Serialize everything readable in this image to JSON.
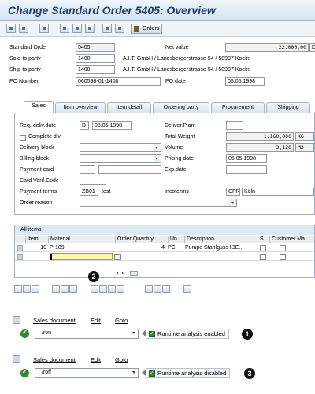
{
  "window": {
    "title": "Change Standard Order 5405: Overview"
  },
  "toolbar": {
    "orders_label": "Orders"
  },
  "header": {
    "standard_order_label": "Standard Order",
    "standard_order_value": "5405",
    "net_value_label": "Net value",
    "net_value_value": "22.000,00",
    "currency_value": "D",
    "sold_to_label": "Sold-to party",
    "sold_to_value": "1400",
    "sold_to_desc": "A.I.T. GmbH / Landsbergerstrasse 54 / 50997 Koeln",
    "ship_to_label": "Ship-to party",
    "ship_to_value": "1400",
    "ship_to_desc": "A.I.T. GmbH / Landsbergerstrasse 54 / 50997 Koeln",
    "po_number_label": "PO Number",
    "po_number_value": "060598-01-1400",
    "po_date_label": "PO date",
    "po_date_value": "05.05.1998"
  },
  "tabs": [
    {
      "label": "Sales"
    },
    {
      "label": "Item overview"
    },
    {
      "label": "Item detail"
    },
    {
      "label": "Ordering party"
    },
    {
      "label": "Procurement"
    },
    {
      "label": "Shipping"
    }
  ],
  "sales": {
    "req_deliv_date_label": "Req. deliv.date",
    "req_deliv_date_unit": "D",
    "req_deliv_date_value": "08.05.1998",
    "deliver_plant_label": "Deliver.Plant",
    "complete_dlv_label": "Complete dlv.",
    "total_weight_label": "Total Weight",
    "total_weight_value": "1.160,000",
    "total_weight_unit": "KG",
    "delivery_block_label": "Delivery block",
    "volume_label": "Volume",
    "volume_value": "3,120",
    "volume_unit": "M3",
    "billing_block_label": "Billing block",
    "pricing_date_label": "Pricing date",
    "pricing_date_value": "06.05.1998",
    "payment_card_label": "Payment card",
    "exp_date_label": "Exp.date",
    "card_verif_label": "Card Verif.Code",
    "payment_terms_label": "Payment terms",
    "payment_terms_value": "ZB01",
    "payment_terms_desc": "test",
    "incoterms_label": "Incoterms",
    "incoterms_value": "CFR",
    "incoterms_place": "Köln",
    "order_reason_label": "Order reason"
  },
  "items": {
    "title": "All items",
    "columns": [
      "Item",
      "Material",
      "Order Quantity",
      "Un",
      "Description",
      "S",
      "Customer Ma"
    ],
    "rows": [
      {
        "item": "10",
        "material": "P-109",
        "quantity": "4",
        "unit": "PC",
        "description": "Pumpe Stahlguss IDE..."
      }
    ]
  },
  "panel1": {
    "menu": [
      "Sales document",
      "Edit",
      "Goto"
    ],
    "command": "/ron",
    "status": "Runtime analysis enabled",
    "badge": "1"
  },
  "panel2": {
    "menu": [
      "Sales document",
      "Edit",
      "Goto"
    ],
    "command": "/roff",
    "status": "Runtime analysis disabled",
    "badge": "3"
  },
  "badge_middle": "2"
}
